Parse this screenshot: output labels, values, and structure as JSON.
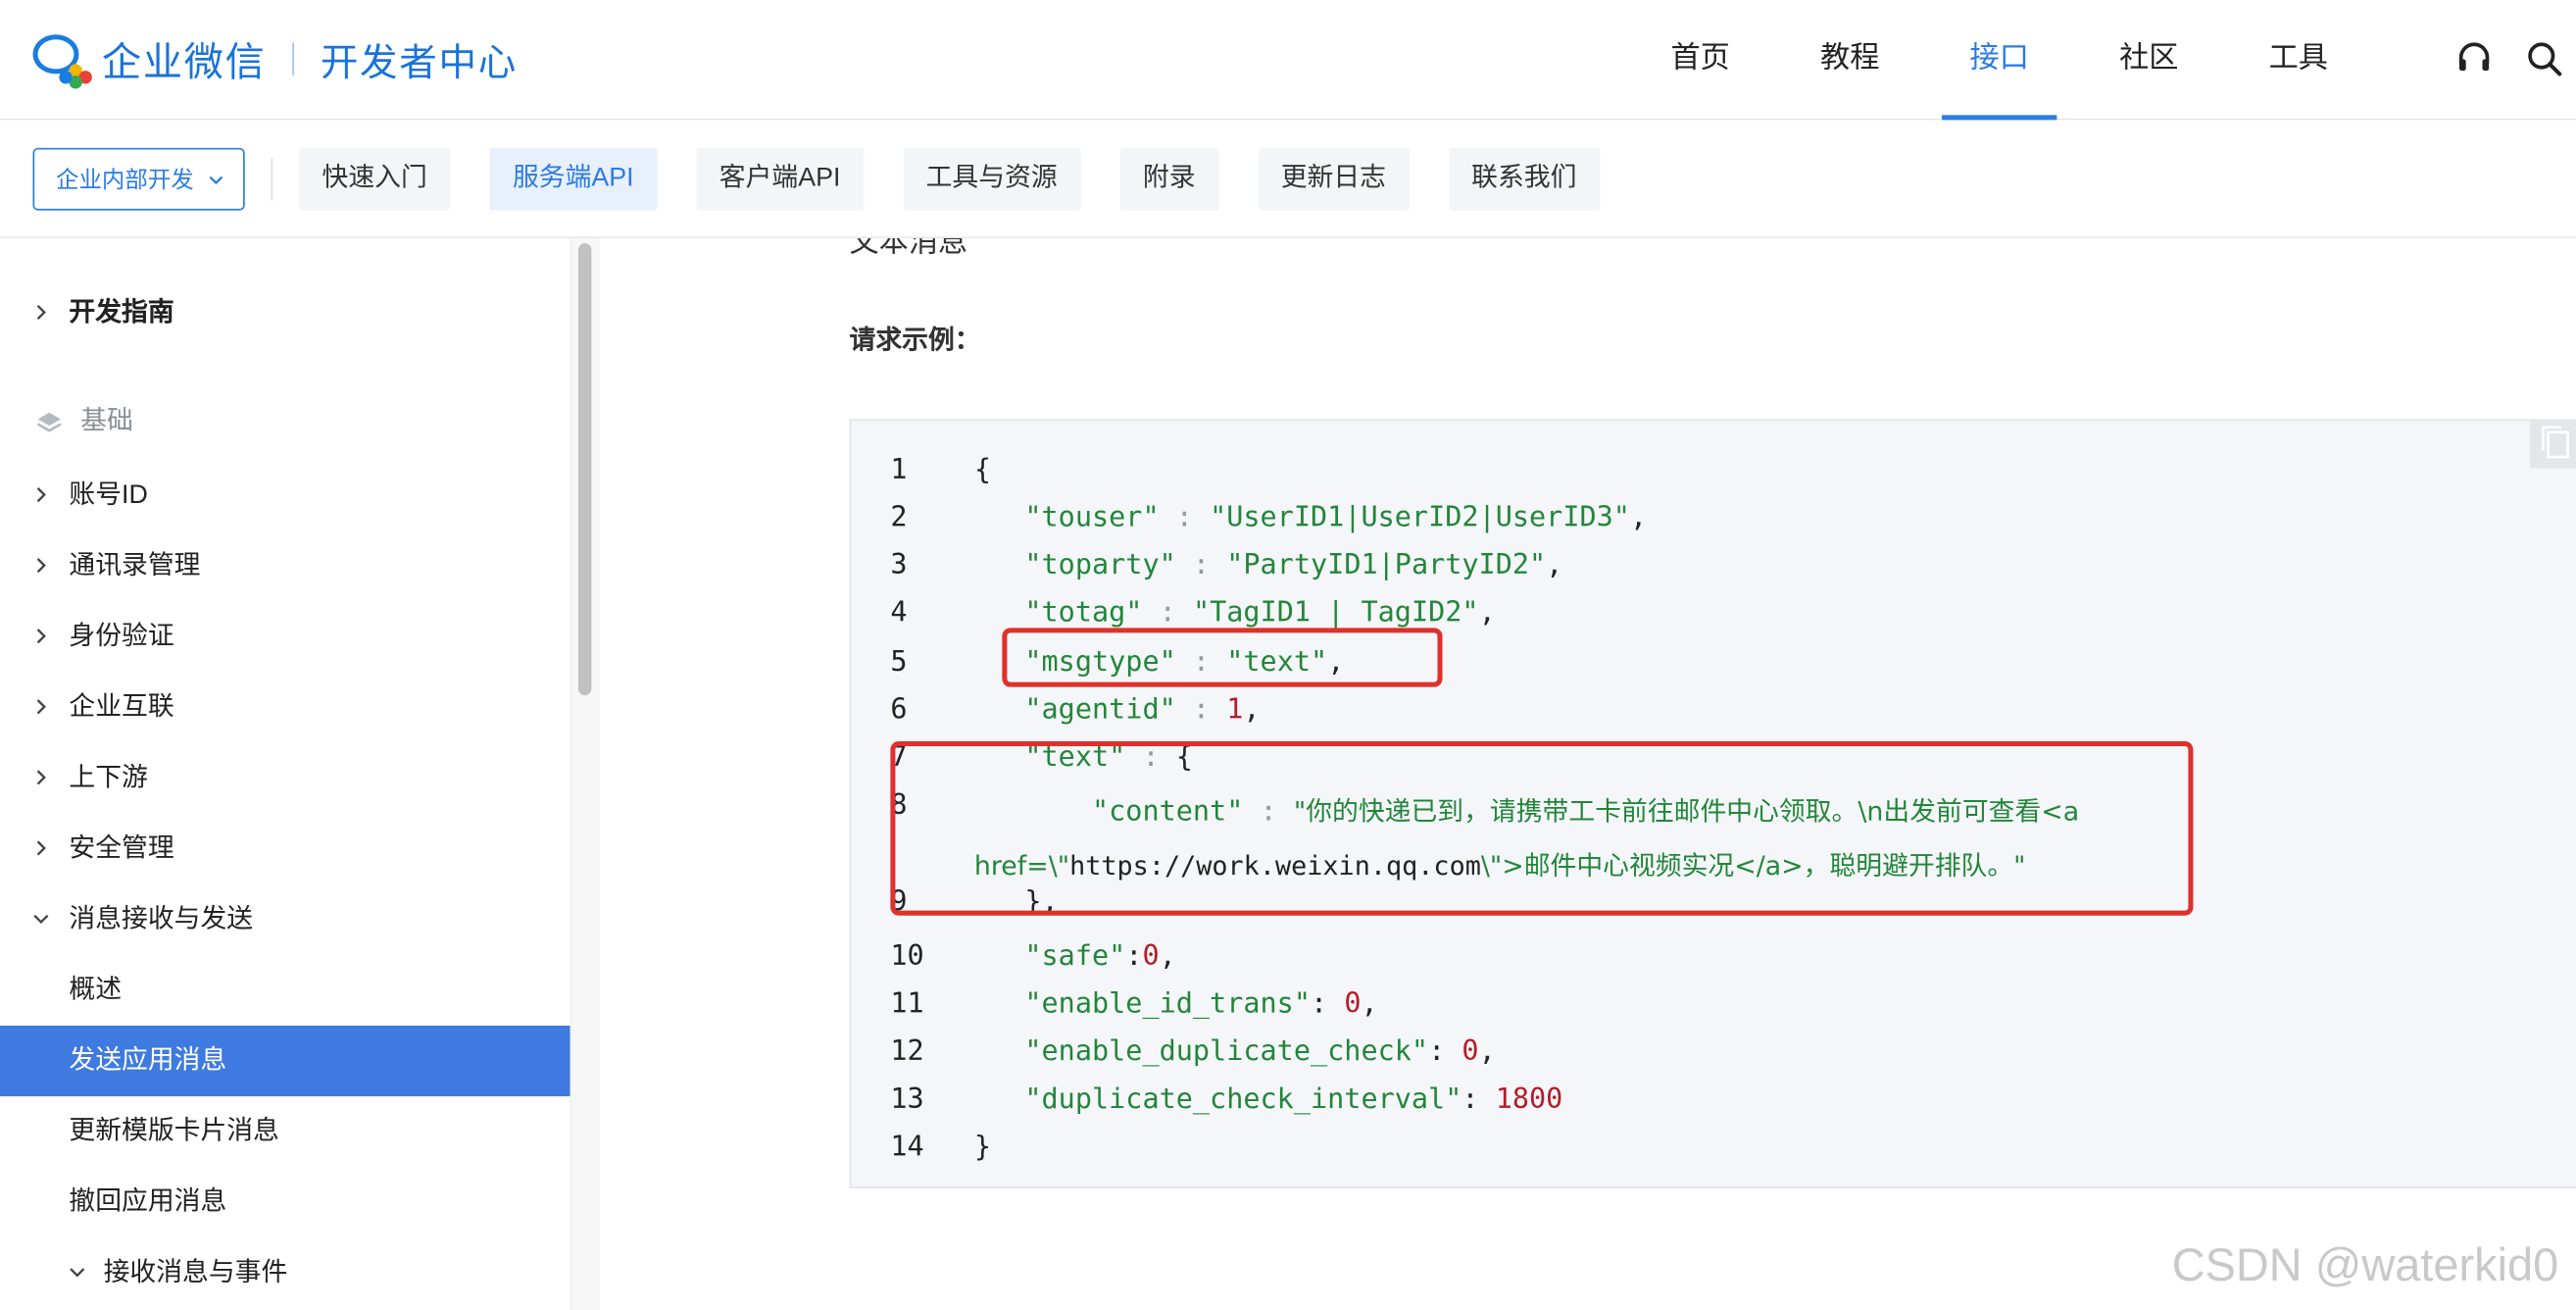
{
  "header": {
    "brand": "企业微信",
    "subtitle": "开发者中心",
    "nav": [
      {
        "label": "首页"
      },
      {
        "label": "教程"
      },
      {
        "label": "接口",
        "active": true
      },
      {
        "label": "社区"
      },
      {
        "label": "工具"
      }
    ],
    "icons": [
      "headset-icon",
      "search-icon"
    ],
    "accent_color": "#2b7be6"
  },
  "subnav": {
    "scope": "企业内部开发",
    "tabs": [
      {
        "label": "快速入门"
      },
      {
        "label": "服务端API",
        "active": true
      },
      {
        "label": "客户端API"
      },
      {
        "label": "工具与资源"
      },
      {
        "label": "附录"
      },
      {
        "label": "更新日志"
      },
      {
        "label": "联系我们"
      }
    ]
  },
  "sidebar": {
    "items": [
      {
        "label": "开发指南",
        "type": "collapsed",
        "bold": true
      },
      {
        "label": "基础",
        "type": "section"
      },
      {
        "label": "账号ID",
        "type": "collapsed"
      },
      {
        "label": "通讯录管理",
        "type": "collapsed"
      },
      {
        "label": "身份验证",
        "type": "collapsed"
      },
      {
        "label": "企业互联",
        "type": "collapsed"
      },
      {
        "label": "上下游",
        "type": "collapsed"
      },
      {
        "label": "安全管理",
        "type": "collapsed"
      },
      {
        "label": "消息接收与发送",
        "type": "expanded"
      },
      {
        "label": "概述",
        "type": "leaf"
      },
      {
        "label": "发送应用消息",
        "type": "leaf",
        "active": true
      },
      {
        "label": "更新模版卡片消息",
        "type": "leaf"
      },
      {
        "label": "撤回应用消息",
        "type": "leaf"
      },
      {
        "label": "接收消息与事件",
        "type": "expanded-child"
      }
    ],
    "active_color": "#3e7ae0"
  },
  "content": {
    "cut_title": "文本消息",
    "request_label": "请求示例：",
    "code": {
      "line_numbers": [
        "1",
        "2",
        "3",
        "4",
        "5",
        "6",
        "7",
        "8",
        "",
        "9",
        "10",
        "11",
        "12",
        "13",
        "14"
      ],
      "touser_key": "\"touser\"",
      "touser_val": "\"UserID1|UserID2|UserID3\"",
      "toparty_key": "\"toparty\"",
      "toparty_val": "\"PartyID1|PartyID2\"",
      "totag_key": "\"totag\"",
      "totag_val": "\"TagID1 | TagID2\"",
      "msgtype_key": "\"msgtype\"",
      "msgtype_val": "\"text\"",
      "agentid_key": "\"agentid\"",
      "agentid_val": "1",
      "text_key": "\"text\"",
      "content_key": "\"content\"",
      "content_val_a": "\"你的快递已到，请携带工卡前往邮件中心领取。\\n出发前可查看<a",
      "content_val_b1": "href=\\\"",
      "content_val_url": "https://work.weixin.qq.com",
      "content_val_b2": "\\\">邮件中心视频实况</a>，聪明避开排队。\"",
      "safe_key": "\"safe\"",
      "safe_val": "0",
      "idtrans_key": "\"enable_id_trans\"",
      "idtrans_val": "0",
      "dupcheck_key": "\"enable_duplicate_check\"",
      "dupcheck_val": "0",
      "dupint_key": "\"duplicate_check_interval\"",
      "dupint_val": "1800"
    },
    "highlight_color": "#e0302b"
  },
  "watermark": "CSDN @waterkid0"
}
